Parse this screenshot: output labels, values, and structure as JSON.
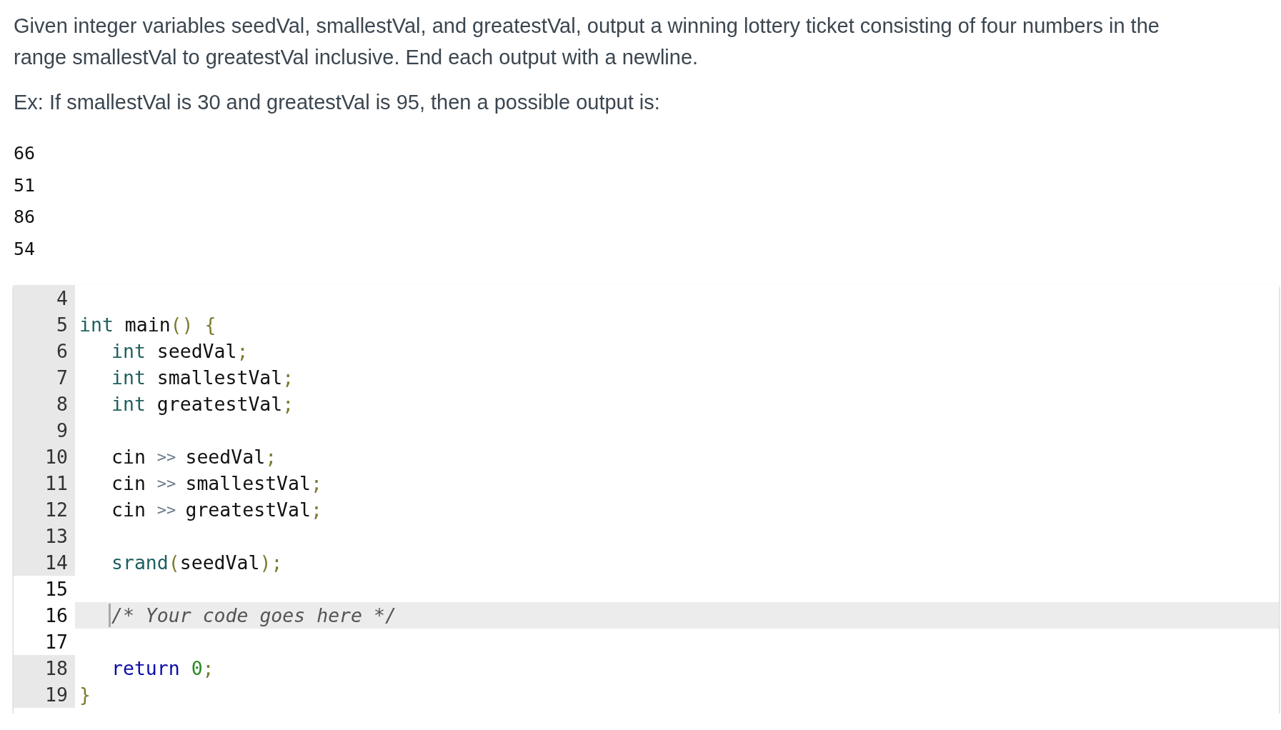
{
  "prompt": {
    "paragraphs": [
      "Given integer variables seedVal, smallestVal, and greatestVal, output a winning lottery ticket consisting of four numbers in the range smallestVal to greatestVal inclusive. End each output with a newline.",
      "Ex: If smallestVal is 30 and greatestVal is 95, then a possible output is:"
    ],
    "sample_output": [
      "66",
      "51",
      "86",
      "54"
    ]
  },
  "editor": {
    "lines": [
      {
        "number": "4",
        "editable": false,
        "active": false
      },
      {
        "number": "5",
        "editable": false,
        "active": false,
        "tokens": [
          {
            "kind": "type",
            "text": "int"
          },
          {
            "kind": "plain",
            "text": "main"
          },
          {
            "kind": "punct",
            "text": "()"
          },
          {
            "kind": "punct",
            "text": "{"
          }
        ],
        "children": [
          {
            "number": "6",
            "editable": false,
            "active": false,
            "tokens": [
              {
                "kind": "type",
                "text": "int"
              },
              {
                "kind": "plain",
                "text": "seedVal"
              },
              {
                "kind": "punct",
                "text": ";"
              }
            ]
          },
          {
            "number": "7",
            "editable": false,
            "active": false,
            "tokens": [
              {
                "kind": "type",
                "text": "int"
              },
              {
                "kind": "plain",
                "text": "smallestVal"
              },
              {
                "kind": "punct",
                "text": ";"
              }
            ]
          },
          {
            "number": "8",
            "editable": false,
            "active": false,
            "tokens": [
              {
                "kind": "type",
                "text": "int"
              },
              {
                "kind": "plain",
                "text": "greatestVal"
              },
              {
                "kind": "punct",
                "text": ";"
              }
            ]
          },
          {
            "number": "9",
            "editable": false,
            "active": false
          },
          {
            "number": "10",
            "editable": false,
            "active": false,
            "tokens": [
              {
                "kind": "plain",
                "text": "cin"
              },
              {
                "kind": "operator",
                "text": ">>"
              },
              {
                "kind": "plain",
                "text": "seedVal"
              },
              {
                "kind": "punct",
                "text": ";"
              }
            ]
          },
          {
            "number": "11",
            "editable": false,
            "active": false,
            "tokens": [
              {
                "kind": "plain",
                "text": "cin"
              },
              {
                "kind": "operator",
                "text": ">>"
              },
              {
                "kind": "plain",
                "text": "smallestVal"
              },
              {
                "kind": "punct",
                "text": ";"
              }
            ]
          },
          {
            "number": "12",
            "editable": false,
            "active": false,
            "tokens": [
              {
                "kind": "plain",
                "text": "cin"
              },
              {
                "kind": "operator",
                "text": ">>"
              },
              {
                "kind": "plain",
                "text": "greatestVal"
              },
              {
                "kind": "punct",
                "text": ";"
              }
            ]
          },
          {
            "number": "13",
            "editable": false,
            "active": false
          },
          {
            "number": "14",
            "editable": false,
            "active": false,
            "tokens": [
              {
                "kind": "type",
                "text": "srand"
              },
              {
                "kind": "punct",
                "text": "("
              },
              {
                "kind": "plain",
                "text": "seedVal"
              },
              {
                "kind": "punct",
                "text": ");"
              }
            ]
          },
          {
            "number": "15",
            "editable": true,
            "active": false
          },
          {
            "number": "16",
            "editable": true,
            "active": true,
            "tokens": [
              {
                "kind": "comment",
                "text": "/* Your code goes here */"
              }
            ]
          },
          {
            "number": "17",
            "editable": true,
            "active": false
          },
          {
            "number": "18",
            "editable": false,
            "active": false,
            "tokens": [
              {
                "kind": "keyword",
                "text": "return"
              },
              {
                "kind": "number",
                "text": "0"
              },
              {
                "kind": "punct",
                "text": ";"
              }
            ]
          }
        ]
      },
      {
        "number": "19",
        "editable": false,
        "active": false,
        "tokens": [
          {
            "kind": "punct",
            "text": "}"
          }
        ]
      }
    ]
  }
}
